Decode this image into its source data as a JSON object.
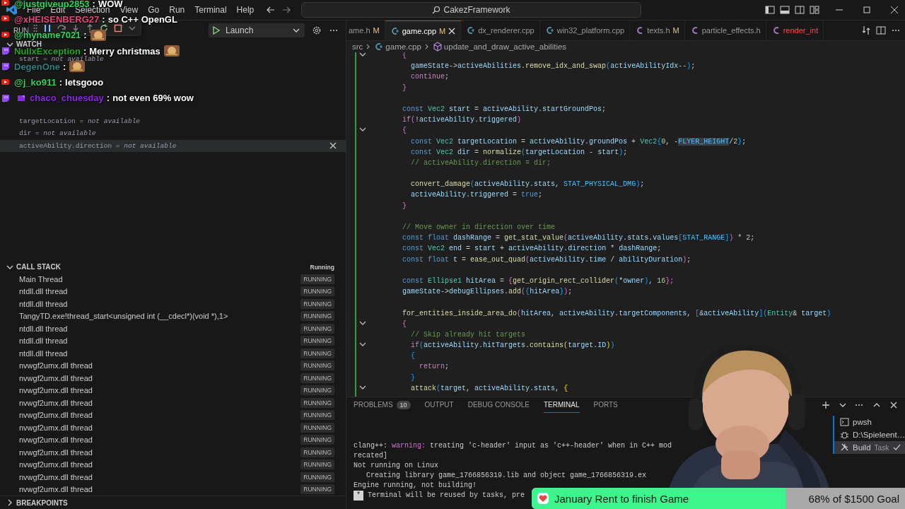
{
  "window": {
    "title": "CakezFramework"
  },
  "menu": [
    "File",
    "Edit",
    "Selection",
    "View",
    "Go",
    "Run",
    "Terminal",
    "Help"
  ],
  "run_view": {
    "title": "RUN",
    "launch": "Launch",
    "watch_title": "WATCH",
    "watch": [
      {
        "text": "start = *not available*",
        "selected": false
      },
      {
        "text": "targetLocation = *not available*",
        "selected": false
      },
      {
        "text": "dir = *not available*",
        "selected": false
      },
      {
        "text": "activeAbility.direction = *not available*",
        "selected": true
      }
    ],
    "call_stack": {
      "title": "CALL STACK",
      "state": "Running",
      "threads": [
        {
          "name": "Main Thread",
          "status": "RUNNING"
        },
        {
          "name": "ntdll.dll thread",
          "status": "RUNNING"
        },
        {
          "name": "ntdll.dll thread",
          "status": "RUNNING"
        },
        {
          "name": "TangyTD.exe!thread_start<unsigned int (__cdecl*)(void *),1>",
          "status": "RUNNING"
        },
        {
          "name": "ntdll.dll thread",
          "status": "RUNNING"
        },
        {
          "name": "ntdll.dll thread",
          "status": "RUNNING"
        },
        {
          "name": "ntdll.dll thread",
          "status": "RUNNING"
        },
        {
          "name": "nvwgf2umx.dll thread",
          "status": "RUNNING"
        },
        {
          "name": "nvwgf2umx.dll thread",
          "status": "RUNNING"
        },
        {
          "name": "nvwgf2umx.dll thread",
          "status": "RUNNING"
        },
        {
          "name": "nvwgf2umx.dll thread",
          "status": "RUNNING"
        },
        {
          "name": "nvwgf2umx.dll thread",
          "status": "RUNNING"
        },
        {
          "name": "nvwgf2umx.dll thread",
          "status": "RUNNING"
        },
        {
          "name": "nvwgf2umx.dll thread",
          "status": "RUNNING"
        },
        {
          "name": "nvwgf2umx.dll thread",
          "status": "RUNNING"
        },
        {
          "name": "nvwgf2umx.dll thread",
          "status": "RUNNING"
        },
        {
          "name": "nvwgf2umx.dll thread",
          "status": "RUNNING"
        },
        {
          "name": "nvwgf2umx.dll thread",
          "status": "RUNNING"
        }
      ]
    },
    "breakpoints_title": "BREAKPOINTS"
  },
  "editor": {
    "tabs": [
      {
        "label": "ame.h",
        "status": "M",
        "selected": false,
        "error": false
      },
      {
        "label": "game.cpp",
        "kind": "cpp",
        "status": "M",
        "selected": true,
        "error": false
      },
      {
        "label": "dx_renderer.cpp",
        "kind": "cpp",
        "selected": false,
        "error": false
      },
      {
        "label": "win32_platform.cpp",
        "kind": "cpp",
        "selected": false,
        "error": false
      },
      {
        "label": "texts.h",
        "kind": "h",
        "status": "M",
        "selected": false,
        "error": false
      },
      {
        "label": "particle_effects.h",
        "kind": "h",
        "selected": false,
        "error": false
      },
      {
        "label": "render_int",
        "kind": "h",
        "selected": false,
        "error": true
      }
    ],
    "breadcrumb": [
      "src",
      "game.cpp",
      "update_and_draw_active_abilities"
    ],
    "lines": [
      {
        "kind": "fold",
        "tokens": [
          {
            "kind": "o",
            "text": "        {"
          }
        ]
      },
      {
        "kind": "code",
        "tokens": [
          {
            "kind": "v",
            "text": "          gameState"
          },
          {
            "kind": "p",
            "text": "->"
          },
          {
            "kind": "v",
            "text": "activeAbilities"
          },
          {
            "kind": "p",
            "text": "."
          },
          {
            "kind": "f",
            "text": "remove_idx_and_swap"
          },
          {
            "kind": "u",
            "text": "("
          },
          {
            "kind": "v",
            "text": "activeAbilityIdx"
          },
          {
            "kind": "p",
            "text": "--"
          },
          {
            "kind": "u",
            "text": ")"
          },
          {
            "kind": "p",
            "text": ";"
          }
        ]
      },
      {
        "kind": "code",
        "tokens": [
          {
            "kind": "c",
            "text": "          continue"
          },
          {
            "kind": "p",
            "text": ";"
          }
        ]
      },
      {
        "kind": "code",
        "tokens": [
          {
            "kind": "o",
            "text": "        }"
          }
        ]
      },
      {
        "kind": "blank"
      },
      {
        "kind": "code",
        "tokens": [
          {
            "kind": "k",
            "text": "        const "
          },
          {
            "kind": "t",
            "text": "Vec2 "
          },
          {
            "kind": "v",
            "text": "start"
          },
          {
            "kind": "p",
            "text": " = "
          },
          {
            "kind": "v",
            "text": "activeAbility"
          },
          {
            "kind": "p",
            "text": "."
          },
          {
            "kind": "v",
            "text": "startGroundPos"
          },
          {
            "kind": "p",
            "text": ";"
          }
        ]
      },
      {
        "kind": "code",
        "tokens": [
          {
            "kind": "c",
            "text": "        if"
          },
          {
            "kind": "o",
            "text": "("
          },
          {
            "kind": "p",
            "text": "!"
          },
          {
            "kind": "v",
            "text": "activeAbility"
          },
          {
            "kind": "p",
            "text": "."
          },
          {
            "kind": "v",
            "text": "triggered"
          },
          {
            "kind": "o",
            "text": ")"
          }
        ]
      },
      {
        "kind": "fold",
        "tokens": [
          {
            "kind": "o",
            "text": "        {"
          }
        ]
      },
      {
        "kind": "code",
        "tokens": [
          {
            "kind": "k",
            "text": "          const "
          },
          {
            "kind": "t",
            "text": "Vec2 "
          },
          {
            "kind": "v",
            "text": "targetLocation"
          },
          {
            "kind": "p",
            "text": " = "
          },
          {
            "kind": "v",
            "text": "activeAbility"
          },
          {
            "kind": "p",
            "text": "."
          },
          {
            "kind": "v",
            "text": "groundPos"
          },
          {
            "kind": "p",
            "text": " + "
          },
          {
            "kind": "t",
            "text": "Vec2"
          },
          {
            "kind": "u",
            "text": "{"
          },
          {
            "kind": "n",
            "text": "0"
          },
          {
            "kind": "p",
            "text": ", -"
          },
          {
            "kind": "s",
            "text": "FLYER_HEIGHT"
          },
          {
            "kind": "p",
            "text": "/"
          },
          {
            "kind": "n",
            "text": "2"
          },
          {
            "kind": "u",
            "text": "}"
          },
          {
            "kind": "p",
            "text": ";"
          }
        ]
      },
      {
        "kind": "code",
        "tokens": [
          {
            "kind": "k",
            "text": "          const "
          },
          {
            "kind": "t",
            "text": "Vec2 "
          },
          {
            "kind": "v",
            "text": "dir"
          },
          {
            "kind": "p",
            "text": " = "
          },
          {
            "kind": "f",
            "text": "normalize"
          },
          {
            "kind": "u",
            "text": "("
          },
          {
            "kind": "v",
            "text": "targetLocation"
          },
          {
            "kind": "p",
            "text": " - "
          },
          {
            "kind": "v",
            "text": "start"
          },
          {
            "kind": "u",
            "text": ")"
          },
          {
            "kind": "p",
            "text": ";"
          }
        ]
      },
      {
        "kind": "code",
        "tokens": [
          {
            "kind": "g",
            "text": "          // activeAbility.direction = dir;"
          }
        ]
      },
      {
        "kind": "blank"
      },
      {
        "kind": "code",
        "tokens": [
          {
            "kind": "f",
            "text": "          convert_damage"
          },
          {
            "kind": "u",
            "text": "("
          },
          {
            "kind": "v",
            "text": "activeAbility"
          },
          {
            "kind": "p",
            "text": "."
          },
          {
            "kind": "v",
            "text": "stats"
          },
          {
            "kind": "p",
            "text": ", "
          },
          {
            "kind": "m",
            "text": "STAT_PHYSICAL_DMG"
          },
          {
            "kind": "u",
            "text": ")"
          },
          {
            "kind": "p",
            "text": ";"
          }
        ]
      },
      {
        "kind": "code",
        "tokens": [
          {
            "kind": "v",
            "text": "          activeAbility"
          },
          {
            "kind": "p",
            "text": "."
          },
          {
            "kind": "v",
            "text": "triggered"
          },
          {
            "kind": "p",
            "text": " = "
          },
          {
            "kind": "k",
            "text": "true"
          },
          {
            "kind": "p",
            "text": ";"
          }
        ]
      },
      {
        "kind": "code",
        "tokens": [
          {
            "kind": "o",
            "text": "        }"
          }
        ]
      },
      {
        "kind": "blank"
      },
      {
        "kind": "code",
        "tokens": [
          {
            "kind": "g",
            "text": "        // Move owner in direction over time"
          }
        ]
      },
      {
        "kind": "code",
        "tokens": [
          {
            "kind": "k",
            "text": "        const float "
          },
          {
            "kind": "v",
            "text": "dashRange"
          },
          {
            "kind": "p",
            "text": " = "
          },
          {
            "kind": "f",
            "text": "get_stat_value"
          },
          {
            "kind": "o",
            "text": "("
          },
          {
            "kind": "v",
            "text": "activeAbility"
          },
          {
            "kind": "p",
            "text": "."
          },
          {
            "kind": "v",
            "text": "stats"
          },
          {
            "kind": "p",
            "text": "."
          },
          {
            "kind": "v",
            "text": "values"
          },
          {
            "kind": "u",
            "text": "["
          },
          {
            "kind": "m",
            "text": "STAT_RANGE"
          },
          {
            "kind": "u",
            "text": "]"
          },
          {
            "kind": "o",
            "text": ")"
          },
          {
            "kind": "p",
            "text": " * "
          },
          {
            "kind": "n",
            "text": "2"
          },
          {
            "kind": "p",
            "text": ";"
          }
        ]
      },
      {
        "kind": "code",
        "tokens": [
          {
            "kind": "k",
            "text": "        const "
          },
          {
            "kind": "t",
            "text": "Vec2 "
          },
          {
            "kind": "v",
            "text": "end"
          },
          {
            "kind": "p",
            "text": " = "
          },
          {
            "kind": "v",
            "text": "start"
          },
          {
            "kind": "p",
            "text": " + "
          },
          {
            "kind": "v",
            "text": "activeAbility"
          },
          {
            "kind": "p",
            "text": "."
          },
          {
            "kind": "v",
            "text": "direction"
          },
          {
            "kind": "p",
            "text": " * "
          },
          {
            "kind": "v",
            "text": "dashRange"
          },
          {
            "kind": "p",
            "text": ";"
          }
        ]
      },
      {
        "kind": "code",
        "tokens": [
          {
            "kind": "k",
            "text": "        const float "
          },
          {
            "kind": "v",
            "text": "t"
          },
          {
            "kind": "p",
            "text": " = "
          },
          {
            "kind": "f",
            "text": "ease_out_quad"
          },
          {
            "kind": "o",
            "text": "("
          },
          {
            "kind": "v",
            "text": "activeAbility"
          },
          {
            "kind": "p",
            "text": "."
          },
          {
            "kind": "v",
            "text": "time"
          },
          {
            "kind": "p",
            "text": " / "
          },
          {
            "kind": "v",
            "text": "abilityDuration"
          },
          {
            "kind": "o",
            "text": ")"
          },
          {
            "kind": "p",
            "text": ";"
          }
        ]
      },
      {
        "kind": "blank"
      },
      {
        "kind": "code",
        "tokens": [
          {
            "kind": "k",
            "text": "        const "
          },
          {
            "kind": "t",
            "text": "Ellipse1 "
          },
          {
            "kind": "v",
            "text": "hitArea"
          },
          {
            "kind": "p",
            "text": " = "
          },
          {
            "kind": "o",
            "text": "{"
          },
          {
            "kind": "f",
            "text": "get_origin_rect_collider"
          },
          {
            "kind": "u",
            "text": "("
          },
          {
            "kind": "p",
            "text": "*"
          },
          {
            "kind": "v",
            "text": "owner"
          },
          {
            "kind": "u",
            "text": ")"
          },
          {
            "kind": "p",
            "text": ", "
          },
          {
            "kind": "n",
            "text": "16"
          },
          {
            "kind": "o",
            "text": "};"
          }
        ]
      },
      {
        "kind": "code",
        "tokens": [
          {
            "kind": "v",
            "text": "        gameState"
          },
          {
            "kind": "p",
            "text": "->"
          },
          {
            "kind": "v",
            "text": "debugEllipses"
          },
          {
            "kind": "p",
            "text": "."
          },
          {
            "kind": "f",
            "text": "add"
          },
          {
            "kind": "o",
            "text": "("
          },
          {
            "kind": "u",
            "text": "{"
          },
          {
            "kind": "v",
            "text": "hitArea"
          },
          {
            "kind": "u",
            "text": "}"
          },
          {
            "kind": "o",
            "text": ")"
          },
          {
            "kind": "p",
            "text": ";"
          }
        ]
      },
      {
        "kind": "blank"
      },
      {
        "kind": "code",
        "tokens": [
          {
            "kind": "f",
            "text": "        for_entities_inside_area_do"
          },
          {
            "kind": "o",
            "text": "("
          },
          {
            "kind": "v",
            "text": "hitArea"
          },
          {
            "kind": "p",
            "text": ", "
          },
          {
            "kind": "v",
            "text": "activeAbility"
          },
          {
            "kind": "p",
            "text": "."
          },
          {
            "kind": "v",
            "text": "targetComponents"
          },
          {
            "kind": "p",
            "text": ", "
          },
          {
            "kind": "u",
            "text": "["
          },
          {
            "kind": "p",
            "text": "&"
          },
          {
            "kind": "v",
            "text": "activeAbility"
          },
          {
            "kind": "u",
            "text": "]("
          },
          {
            "kind": "t",
            "text": "Entity"
          },
          {
            "kind": "p",
            "text": "& "
          },
          {
            "kind": "v",
            "text": "target"
          },
          {
            "kind": "u",
            "text": ")"
          }
        ]
      },
      {
        "kind": "fold",
        "tokens": [
          {
            "kind": "o",
            "text": "        {"
          }
        ]
      },
      {
        "kind": "code",
        "tokens": [
          {
            "kind": "g",
            "text": "          // Skip already hit targets"
          }
        ]
      },
      {
        "kind": "fold",
        "tokens": [
          {
            "kind": "c",
            "text": "          if"
          },
          {
            "kind": "u",
            "text": "("
          },
          {
            "kind": "v",
            "text": "activeAbility"
          },
          {
            "kind": "p",
            "text": "."
          },
          {
            "kind": "v",
            "text": "hitTargets"
          },
          {
            "kind": "p",
            "text": "."
          },
          {
            "kind": "f",
            "text": "contains"
          },
          {
            "kind": "y",
            "text": "("
          },
          {
            "kind": "v",
            "text": "target"
          },
          {
            "kind": "p",
            "text": "."
          },
          {
            "kind": "v",
            "text": "ID"
          },
          {
            "kind": "y",
            "text": ")"
          },
          {
            "kind": "u",
            "text": ")"
          }
        ]
      },
      {
        "kind": "code",
        "tokens": [
          {
            "kind": "u",
            "text": "          {"
          }
        ]
      },
      {
        "kind": "code",
        "tokens": [
          {
            "kind": "c",
            "text": "            return"
          },
          {
            "kind": "p",
            "text": ";"
          }
        ]
      },
      {
        "kind": "code",
        "tokens": [
          {
            "kind": "u",
            "text": "          }"
          }
        ]
      },
      {
        "kind": "fold",
        "tokens": [
          {
            "kind": "f",
            "text": "          attack"
          },
          {
            "kind": "u",
            "text": "("
          },
          {
            "kind": "v",
            "text": "target"
          },
          {
            "kind": "p",
            "text": ", "
          },
          {
            "kind": "v",
            "text": "activeAbility"
          },
          {
            "kind": "p",
            "text": "."
          },
          {
            "kind": "v",
            "text": "stats"
          },
          {
            "kind": "p",
            "text": ", "
          },
          {
            "kind": "y",
            "text": "{"
          }
        ]
      }
    ]
  },
  "panel": {
    "tabs": [
      {
        "label": "PROBLEMS",
        "count": "10",
        "selected": false
      },
      {
        "label": "OUTPUT",
        "selected": false
      },
      {
        "label": "DEBUG CONSOLE",
        "selected": false
      },
      {
        "label": "TERMINAL",
        "selected": true
      },
      {
        "label": "PORTS",
        "selected": false
      }
    ],
    "terminal": [
      {
        "kind": "text",
        "parts": [
          {
            "kind": "p",
            "text": "clang++: "
          },
          {
            "kind": "w",
            "text": "warning:"
          },
          {
            "kind": "p",
            "text": " treating 'c-header' input as 'c++-header' when in C++ mod"
          }
        ]
      },
      {
        "kind": "text",
        "parts": [
          {
            "kind": "p",
            "text": "recated]"
          }
        ]
      },
      {
        "kind": "text",
        "parts": [
          {
            "kind": "p",
            "text": "Not running on Linux"
          }
        ]
      },
      {
        "kind": "text",
        "parts": [
          {
            "kind": "p",
            "text": "   Creating library game_1766856319.lib and object game_1766856319.ex"
          }
        ]
      },
      {
        "kind": "text",
        "parts": [
          {
            "kind": "p",
            "text": "Engine running, not building!"
          }
        ]
      },
      {
        "kind": "notice",
        "mark": "*",
        "text": "Terminal will be reused by tasks, pre"
      }
    ],
    "sessions": [
      {
        "kind": "shell",
        "label": "pwsh",
        "selected": false
      },
      {
        "kind": "debug",
        "label": "D:\\Spieleent…",
        "selected": false
      },
      {
        "kind": "task",
        "label": "Build",
        "sub": "Task",
        "selected": true
      }
    ]
  },
  "chat": [
    {
      "badges": [
        {
          "kind": "youtube"
        }
      ],
      "user": "@justgiveup2853",
      "separator": ":",
      "color": "#33d45a",
      "parts": [
        {
          "kind": "text",
          "text": "WOW"
        }
      ]
    },
    {
      "badges": [
        {
          "kind": "youtube"
        }
      ],
      "user": "@xHEISENBERG27",
      "separator": ":",
      "color": "#e8447c",
      "parts": [
        {
          "kind": "text",
          "text": "so C++ OpenGL"
        }
      ]
    },
    {
      "badges": [
        {
          "kind": "youtube"
        }
      ],
      "user": "@myname7021",
      "separator": ":",
      "color": "#33d45a",
      "parts": [
        {
          "kind": "emote"
        }
      ]
    },
    {
      "badges": [
        {
          "kind": "twitch"
        }
      ],
      "user": "NullxException",
      "separator": ":",
      "color": "#22a822",
      "parts": [
        {
          "kind": "text",
          "text": "Merry christmas"
        },
        {
          "kind": "emote"
        }
      ]
    },
    {
      "badges": [
        {
          "kind": "twitch"
        }
      ],
      "user": "DegenOne",
      "separator": ":",
      "color": "#2e7f86",
      "parts": [
        {
          "kind": "emote"
        }
      ]
    },
    {
      "badges": [
        {
          "kind": "youtube"
        }
      ],
      "user": "@j_ko911",
      "separator": ":",
      "color": "#33d45a",
      "parts": [
        {
          "kind": "text",
          "text": "letsgooo"
        }
      ]
    },
    {
      "badges": [
        {
          "kind": "twitch"
        },
        {
          "kind": "subscriber"
        }
      ],
      "user": "chaco_chuesday",
      "separator": ":",
      "color": "#8a2be2",
      "parts": [
        {
          "kind": "text",
          "text": "not even 69% wow"
        }
      ]
    }
  ],
  "goal": {
    "title": "January Rent to finish Game",
    "progress": "68% of $1500 Goal",
    "level": 0.68
  }
}
